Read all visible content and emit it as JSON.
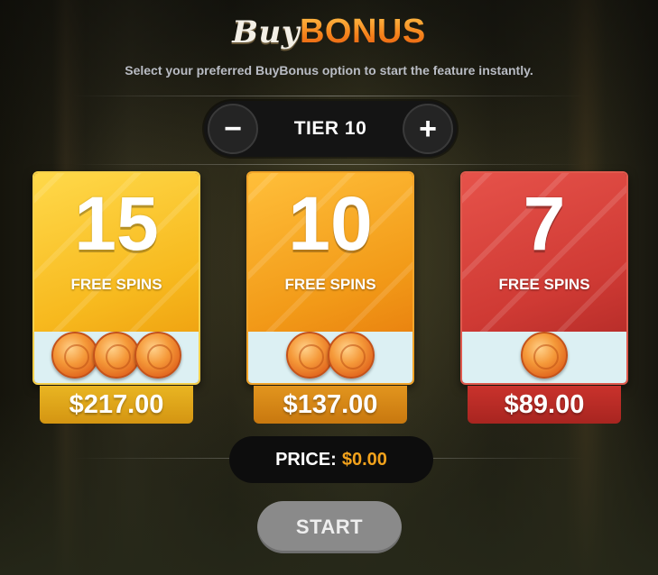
{
  "header": {
    "title_part1": "Buy",
    "title_part2": "BONUS",
    "subtitle": "Select your preferred BuyBonus option to start the feature instantly."
  },
  "tier": {
    "decrease_label": "−",
    "label": "TIER 10",
    "increase_label": "+"
  },
  "options": [
    {
      "spins": "15",
      "label": "FREE SPINS",
      "coins": 3,
      "price": "$217.00",
      "color": "#f7b91e"
    },
    {
      "spins": "10",
      "label": "FREE SPINS",
      "coins": 2,
      "price": "$137.00",
      "color": "#f29a18"
    },
    {
      "spins": "7",
      "label": "FREE SPINS",
      "coins": 1,
      "price": "$89.00",
      "color": "#cf3a34"
    }
  ],
  "summary": {
    "price_label": "PRICE:",
    "price_value": "$0.00"
  },
  "start_label": "START",
  "colors": {
    "accent": "#f2a21c",
    "start_button": "#8a8a8a"
  }
}
